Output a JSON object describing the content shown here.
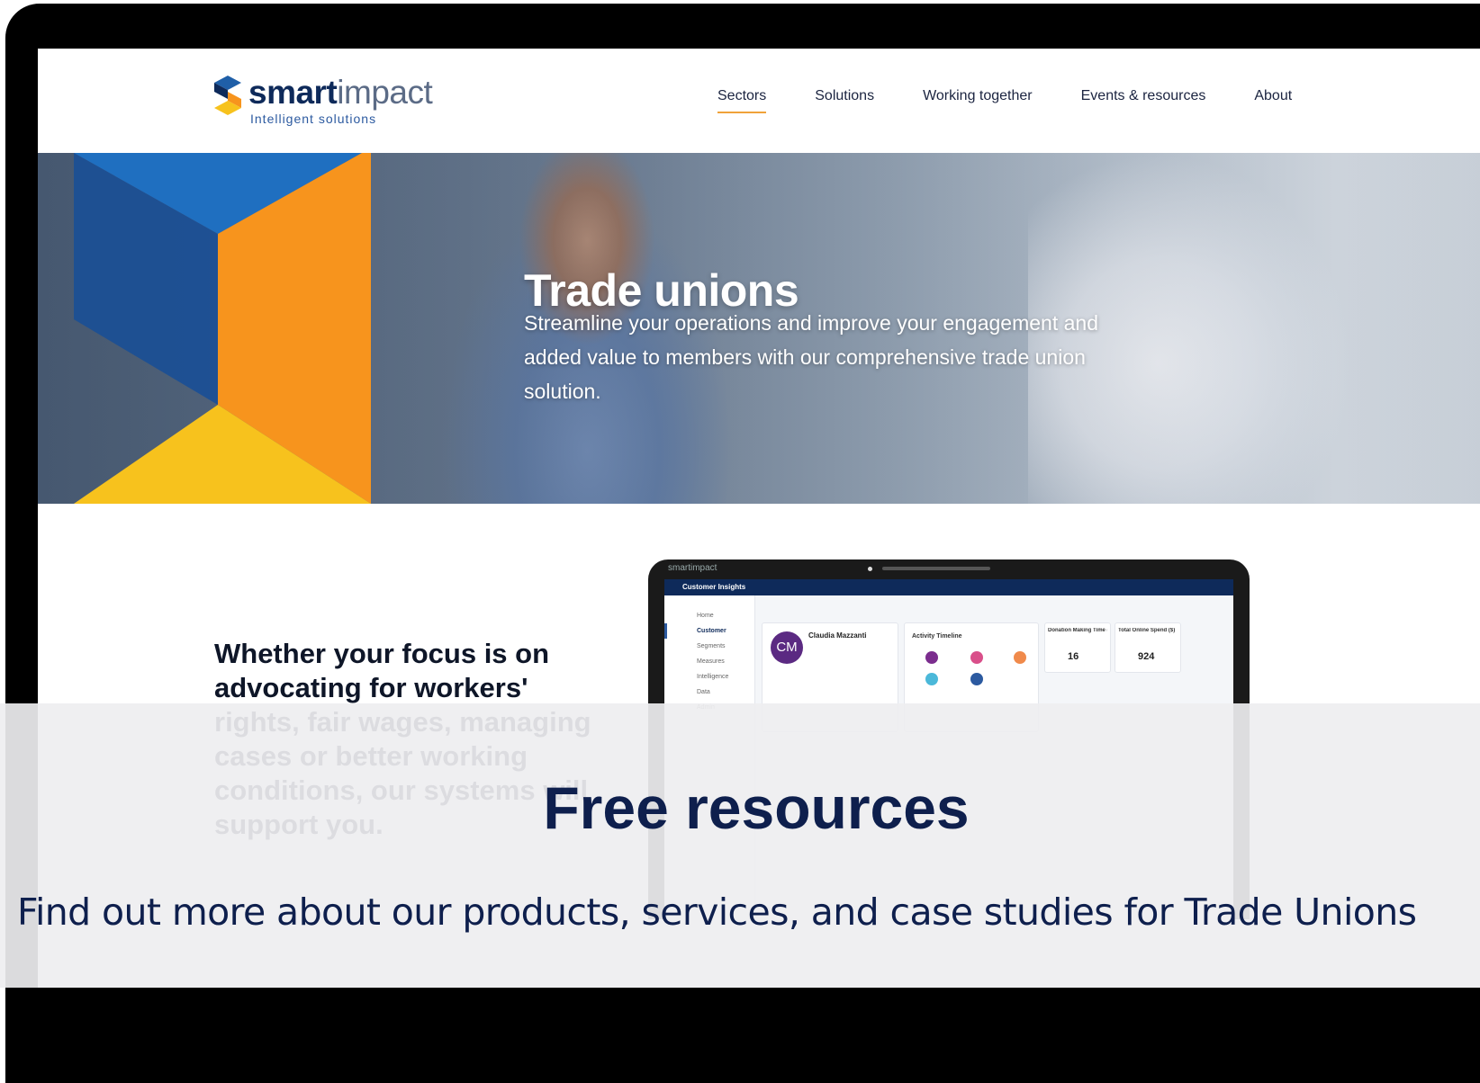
{
  "header": {
    "logo_word_bold": "smart",
    "logo_word_light": "impact",
    "logo_tagline": "Intelligent solutions",
    "nav": [
      {
        "label": "Sectors",
        "active": true
      },
      {
        "label": "Solutions"
      },
      {
        "label": "Working together"
      },
      {
        "label": "Events & resources"
      },
      {
        "label": "About"
      }
    ]
  },
  "hero": {
    "title": "Trade unions",
    "description": "Streamline your operations and improve your engagement and added value to members with our comprehensive trade union solution."
  },
  "section": {
    "focus_text": "Whether your focus is on advocating for workers' rights, fair wages, managing cases or better working conditions, our systems will support you."
  },
  "device": {
    "brand": "smartimpact",
    "app_title": "Customer Insights",
    "sidebar": [
      "Home",
      "Customer",
      "Segments",
      "Measures",
      "Intelligence",
      "Data",
      "Admin"
    ],
    "customer_initials": "CM",
    "customer_name": "Claudia Mazzanti",
    "activity_title": "Activity Timeline",
    "kpis": [
      {
        "label": "Donation Making Time (l)...",
        "value": "16"
      },
      {
        "label": "Total Online Spend ($)",
        "value": "924"
      }
    ]
  },
  "overlay": {
    "title": "Free resources",
    "subtitle": "Find out more about our products, services, and case studies for Trade Unions"
  },
  "colors": {
    "brand_navy": "#0e2a5a",
    "accent_orange": "#f7941d",
    "accent_yellow": "#f7c21d",
    "accent_blue": "#1f5fa8",
    "nav_underline": "#f0a23a"
  }
}
